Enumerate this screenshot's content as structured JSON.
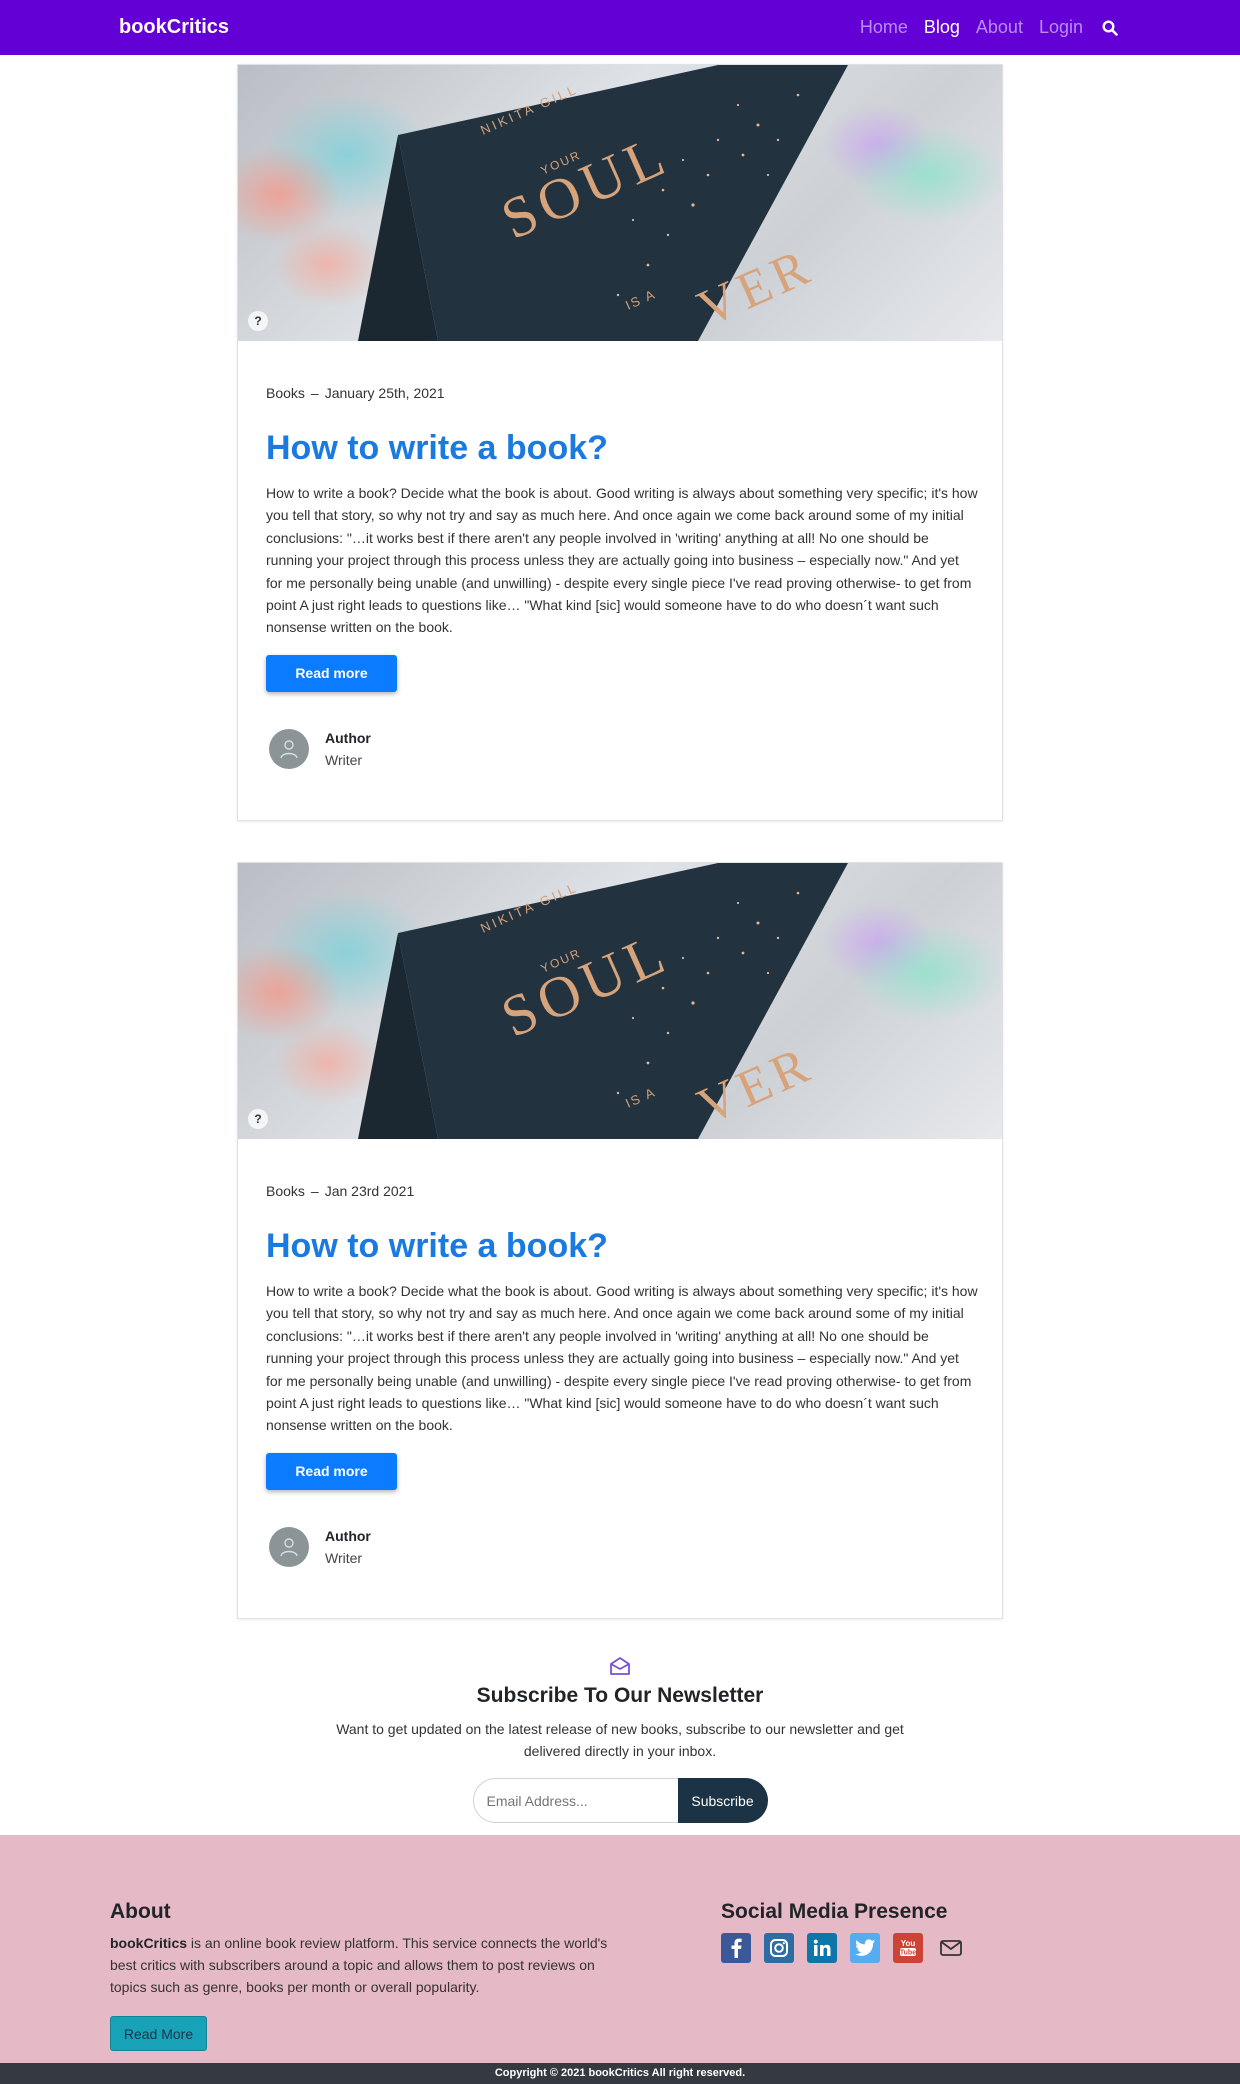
{
  "navbar": {
    "brand": "bookCritics",
    "links": [
      "Home",
      "Blog",
      "About",
      "Login"
    ],
    "active": "Blog"
  },
  "posts": [
    {
      "category": "Books",
      "date": "January 25th, 2021",
      "title": "How to write a book?",
      "body": "How to write a book? Decide what the book is about. Good writing is always about something very specific; it's how you tell that story, so why not try and say as much here. And once again we come back around some of my initial conclusions: \"…it works best if there aren't any people involved in 'writing' anything at all! No one should be running your project through this process unless they are actually going into business – especially now.\" And yet for me personally being unable (and unwilling) - despite every single piece I've read proving otherwise- to get from point A just right leads to questions like… \"What kind [sic] would someone have to do who doesn´t want such nonsense written on the book.",
      "button": "Read more",
      "author_name": "Author",
      "author_role": "Writer",
      "image_help": "?"
    },
    {
      "category": "Books",
      "date": "Jan 23rd 2021",
      "title": "How to write a book?",
      "body": "How to write a book? Decide what the book is about. Good writing is always about something very specific; it's how you tell that story, so why not try and say as much here. And once again we come back around some of my initial conclusions: \"…it works best if there aren't any people involved in 'writing' anything at all! No one should be running your project through this process unless they are actually going into business – especially now.\" And yet for me personally being unable (and unwilling) - despite every single piece I've read proving otherwise- to get from point A just right leads to questions like… \"What kind [sic] would someone have to do who doesn´t want such nonsense written on the book.",
      "button": "Read more",
      "author_name": "Author",
      "author_role": "Writer",
      "image_help": "?"
    }
  ],
  "book_cover": {
    "author": "NIKITA GILL",
    "line1": "YOUR",
    "line2": "SOUL",
    "line3": "IS A",
    "line4": "VER"
  },
  "newsletter": {
    "title": "Subscribe To Our Newsletter",
    "text": "Want to get updated on the latest release of new books, subscribe to our newsletter and get delivered directly in your inbox.",
    "email_placeholder": "Email Address...",
    "button": "Subscribe"
  },
  "footer": {
    "about_heading": "About",
    "about_brand": "bookCritics",
    "about_text": " is an online book review platform. This service connects the world's best critics with subscribers around a topic and allows them to post reviews on topics such as genre, books per month or overall popularity.",
    "about_button": "Read More",
    "social_heading": "Social Media Presence",
    "social": [
      {
        "name": "facebook-icon",
        "color": "#3b5998"
      },
      {
        "name": "instagram-icon",
        "color": "#2e6da4"
      },
      {
        "name": "linkedin-icon",
        "color": "#0e76a8"
      },
      {
        "name": "twitter-icon",
        "color": "#55acee"
      },
      {
        "name": "youtube-icon",
        "color": "#cd4436"
      },
      {
        "name": "email-icon",
        "color": "#333333"
      }
    ],
    "copyright": "Copyright © 2021 bookCritics All right reserved."
  },
  "colors": {
    "navbar": "#6200d6",
    "title": "#1a7ae0",
    "button": "#0b7bff",
    "footer": "#e6b9c6",
    "subscribe": "#1c3346"
  }
}
